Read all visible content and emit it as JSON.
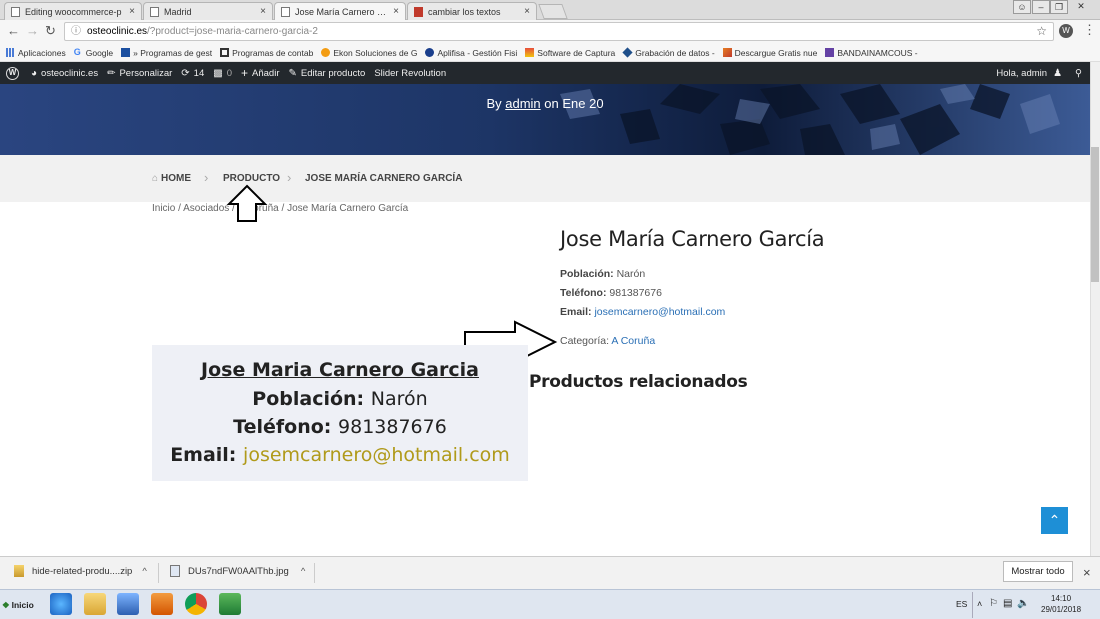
{
  "browser": {
    "tabs": [
      {
        "label": "Editing woocommerce-p",
        "close": "×"
      },
      {
        "label": "Madrid",
        "close": "×"
      },
      {
        "label": "Jose María Carnero Garc",
        "close": "×"
      },
      {
        "label": "cambiar los textos",
        "close": "×"
      }
    ],
    "url_host": "osteoclinic.es",
    "url_path": "/?product=jose-maria-carnero-garcia-2"
  },
  "bookmarks": [
    "Aplicaciones",
    "Google",
    "» Programas de gest",
    "Programas de contab",
    "Ekon Soluciones de G",
    "Aplifisa - Gestión Fisi",
    "Software de Captura",
    "Grabación de datos -",
    "Descargue Gratis nue",
    "BANDAINAMCOUS -"
  ],
  "adminbar": {
    "site": "osteoclinic.es",
    "customize": "Personalizar",
    "updates": "14",
    "comments": "0",
    "add": "Añadir",
    "edit": "Editar producto",
    "slider": "Slider Revolution",
    "greeting": "Hola, admin"
  },
  "hero": {
    "by": "By",
    "author": "admin",
    "date": "on Ene 20"
  },
  "crumbs": {
    "home": "HOME",
    "product": "PRODUCTO",
    "current": "JOSE MARÍA CARNERO GARCÍA"
  },
  "wc_breadcrumb": "Inicio / Asociados / A Coruña / Jose María Carnero García",
  "product": {
    "title": "Jose María Carnero García",
    "poblacion_label": "Población:",
    "poblacion": "Narón",
    "telefono_label": "Teléfono:",
    "telefono": "981387676",
    "email_label": "Email:",
    "email": "josemcarnero@hotmail.com",
    "categoria_label": "Categoría:",
    "categoria": "A Coruña",
    "related": "Productos relacionados"
  },
  "image_card": {
    "name": "Jose Maria Carnero Garcia",
    "poblacion_label": "Población:",
    "poblacion": "Narón",
    "telefono_label": "Teléfono:",
    "telefono": "981387676",
    "email_label": "Email:",
    "email": "josemcarnero@hotmail.com"
  },
  "downloads": [
    {
      "name": "hide-related-produ....zip",
      "chevron": "^"
    },
    {
      "name": "DUs7ndFW0AAlThb.jpg",
      "chevron": "^"
    }
  ],
  "download_bar": {
    "show_all": "Mostrar todo",
    "close": "×"
  },
  "taskbar": {
    "start": "Inicio",
    "lang": "ES",
    "time": "14:10",
    "date": "29/01/2018"
  },
  "colors": {
    "adminbar": "#23282d",
    "link": "#2a6fb5",
    "to_top": "#1e8fd6",
    "hero": "#1e3260"
  }
}
